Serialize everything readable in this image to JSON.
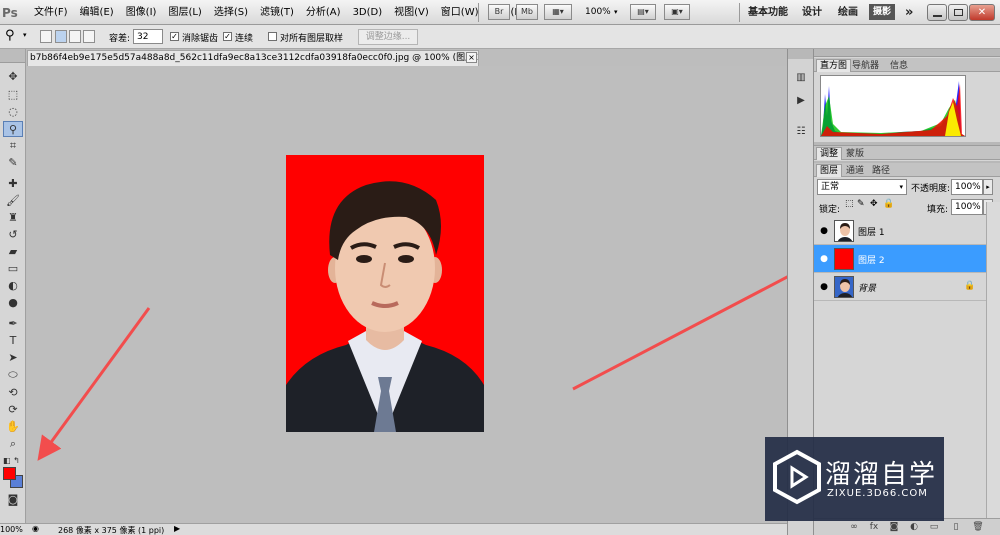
{
  "app": {
    "logo_text": "Ps"
  },
  "menu": [
    "文件(F)",
    "编辑(E)",
    "图像(I)",
    "图层(L)",
    "选择(S)",
    "滤镜(T)",
    "分析(A)",
    "3D(D)",
    "视图(V)",
    "窗口(W)",
    "帮助(H)"
  ],
  "menubar": {
    "bridge_label": "Br",
    "minibridge_label": "Mb",
    "zoom_value": "100%",
    "workspaces": [
      "基本功能",
      "设计",
      "绘画"
    ],
    "active_workspace": "摄影",
    "more": "»"
  },
  "options": {
    "tolerance_label": "容差:",
    "tolerance_value": "32",
    "anti_alias_label": "消除锯齿",
    "anti_alias_checked": true,
    "contiguous_label": "连续",
    "contiguous_checked": true,
    "sample_all_layers_label": "对所有图层取样",
    "sample_all_layers_checked": false,
    "refine_edge_label": "调整边缘..."
  },
  "document": {
    "tab_title": "b7b86f4eb9e175e5d57a488a8d_562c11dfa9ec8a13ce3112cdfa03918fa0ecc0f0.jpg @ 100% (图层 2, RGB/8) *",
    "close_glyph": "×",
    "background_color": "#ff0000"
  },
  "status": {
    "zoom": "100%",
    "doc_info": "268 像素 x 375 像素 (1 ppi)"
  },
  "colors": {
    "foreground": "#ff0000",
    "background": "#5a7fd6",
    "selection": "#3b9cff",
    "annotation_arrow": "#f24d4d"
  },
  "histogram_panel": {
    "tabs": [
      "直方图",
      "导航器",
      "信息"
    ],
    "active_tab": "直方图"
  },
  "adjust_panel": {
    "tabs": [
      "调整",
      "蒙版"
    ],
    "active_tab": "调整"
  },
  "layers_panel": {
    "tabs": [
      "图层",
      "通道",
      "路径"
    ],
    "active_tab": "图层",
    "blend_mode": "正常",
    "opacity_label": "不透明度:",
    "opacity_value": "100%",
    "lock_label": "锁定:",
    "fill_label": "填充:",
    "fill_value": "100%",
    "layers": [
      {
        "name": "图层 1",
        "selected": false,
        "locked": false,
        "thumb": "portrait"
      },
      {
        "name": "图层 2",
        "selected": true,
        "locked": false,
        "thumb": "red"
      },
      {
        "name": "背景",
        "selected": false,
        "locked": true,
        "thumb": "portrait-blue"
      }
    ]
  },
  "watermark": {
    "title": "溜溜自学",
    "subtitle": "ZIXUE.3D66.COM"
  }
}
